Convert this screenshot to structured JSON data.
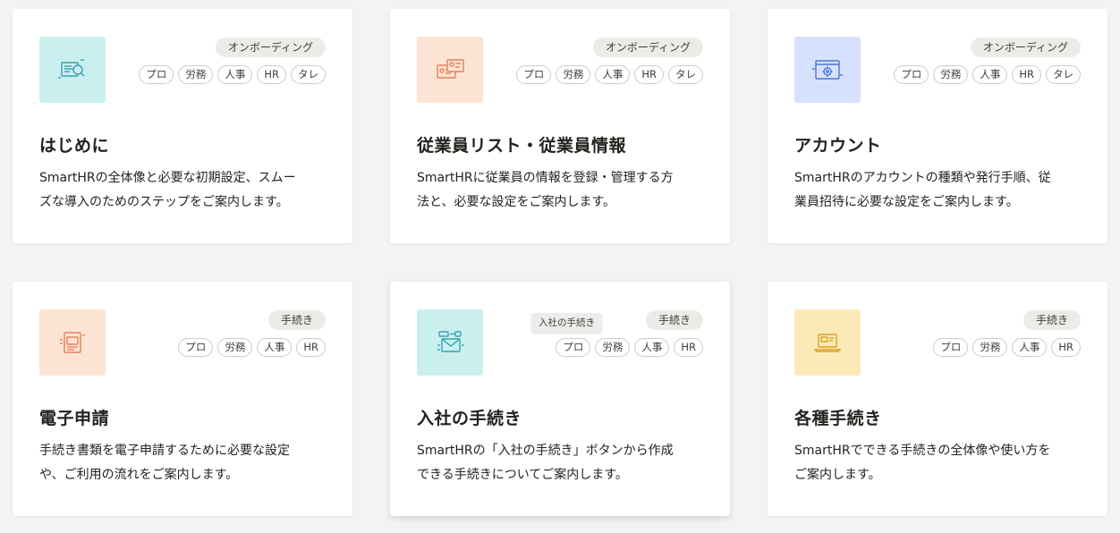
{
  "colors": {
    "teal_thumb": "#c9f0ee",
    "peach_thumb": "#fde3d3",
    "blue_thumb": "#d6e2fb",
    "yellow_thumb": "#fbeab8"
  },
  "cards": [
    {
      "icon": "document-search-icon",
      "category": "オンボーディング",
      "chips": [
        "プロ",
        "労務",
        "人事",
        "HR",
        "タレ"
      ],
      "title": "はじめに",
      "desc_line1": "SmartHRの全体像と必要な初期設定、スムー",
      "desc_line2": "ズな導入のためのステップをご案内します。"
    },
    {
      "icon": "employee-cards-icon",
      "category": "オンボーディング",
      "chips": [
        "プロ",
        "労務",
        "人事",
        "HR",
        "タレ"
      ],
      "title": "従業員リスト・従業員情報",
      "desc_line1": "SmartHRに従業員の情報を登録・管理する方",
      "desc_line2": "法と、必要な設定をご案内します。"
    },
    {
      "icon": "browser-gear-icon",
      "category": "オンボーディング",
      "chips": [
        "プロ",
        "労務",
        "人事",
        "HR",
        "タレ"
      ],
      "title": "アカウント",
      "desc_line1": "SmartHRのアカウントの種類や発行手順、従",
      "desc_line2": "業員招待に必要な設定をご案内します。"
    },
    {
      "icon": "digital-document-icon",
      "category": "手続き",
      "chips": [
        "プロ",
        "労務",
        "人事",
        "HR"
      ],
      "title": "電子申請",
      "desc_line1": "手続き書類を電子申請するために必要な設定",
      "desc_line2": "や、ご利用の流れをご案内します。"
    },
    {
      "icon": "mail-envelope-icon",
      "category": "手続き",
      "chips": [
        "プロ",
        "労務",
        "人事",
        "HR"
      ],
      "title": "入社の手続き",
      "desc_line1": "SmartHRの「入社の手続き」ボタンから作成",
      "desc_line2": "できる手続きについてご案内します。",
      "tooltip": "入社の手続き"
    },
    {
      "icon": "laptop-icon",
      "category": "手続き",
      "chips": [
        "プロ",
        "労務",
        "人事",
        "HR"
      ],
      "title": "各種手続き",
      "desc_line1": "SmartHRでできる手続きの全体像や使い方を",
      "desc_line2": "ご案内します。"
    }
  ]
}
